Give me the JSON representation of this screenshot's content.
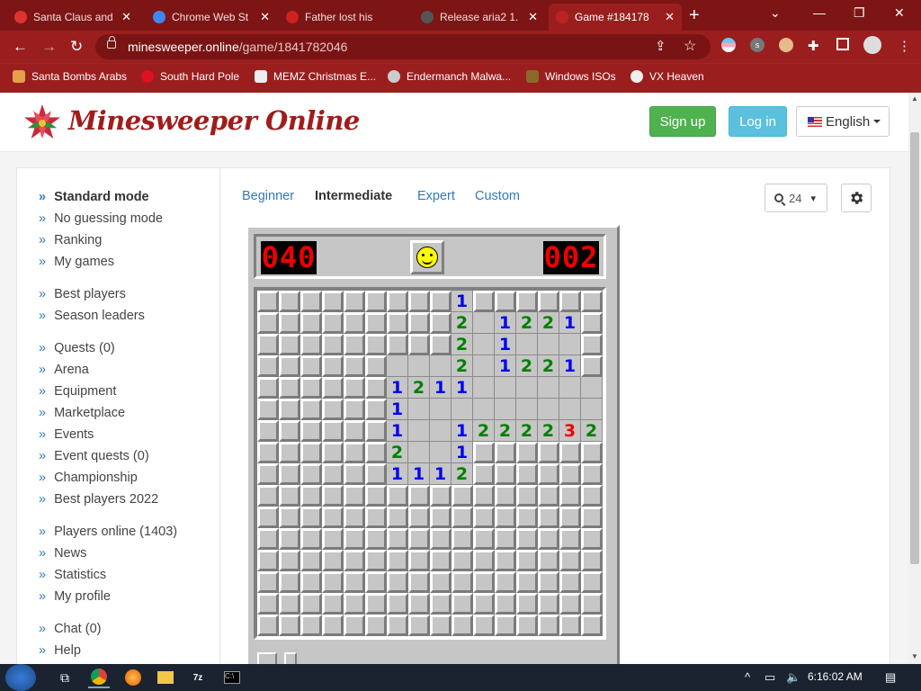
{
  "browser": {
    "tabs": [
      {
        "title": "Santa Claus and",
        "active": false
      },
      {
        "title": "Chrome Web St",
        "active": false
      },
      {
        "title": "Father lost his",
        "active": false
      },
      {
        "title": "Release aria2 1.",
        "active": false
      },
      {
        "title": "Game #184178",
        "active": true
      }
    ],
    "url_host": "minesweeper.online",
    "url_path": "/game/1841782046",
    "bookmarks": [
      "Santa Bombs Arabs",
      "South Hard Pole",
      "MEMZ Christmas E...",
      "Endermanch Malwa...",
      "Windows ISOs",
      "VX Heaven"
    ],
    "theme_color": "#9b1e1e"
  },
  "site": {
    "logo": "Minesweeper Online",
    "signup": "Sign up",
    "login": "Log in",
    "language": "English"
  },
  "sidebar": {
    "groups": [
      [
        "Standard mode",
        "No guessing mode",
        "Ranking",
        "My games"
      ],
      [
        "Best players",
        "Season leaders"
      ],
      [
        "Quests (0)",
        "Arena",
        "Equipment",
        "Marketplace",
        "Events",
        "Event quests (0)",
        "Championship",
        "Best players 2022"
      ],
      [
        "Players online (1403)",
        "News",
        "Statistics",
        "My profile"
      ],
      [
        "Chat (0)",
        "Help"
      ]
    ],
    "active": "Standard mode"
  },
  "levels": {
    "items": [
      "Beginner",
      "Intermediate",
      "Expert",
      "Custom"
    ],
    "active": "Intermediate"
  },
  "zoom": "24",
  "game": {
    "mines_left": "040",
    "timer": "002",
    "cols": 16,
    "rows": 16,
    "board": [
      "#########1######",
      "#########2 .1221",
      "#########2 .1...",
      "######...2 .1221",
      "######1211......",
      "######1.........",
      "######1..122223 2",
      "######2..1######",
      "######1112######",
      "################",
      "################",
      "################",
      "################",
      "################",
      "################",
      "################"
    ],
    "board_legend": "# closed cell, . open empty cell, digit = revealed number"
  },
  "taskbar": {
    "clock": "6:16:02 AM"
  }
}
